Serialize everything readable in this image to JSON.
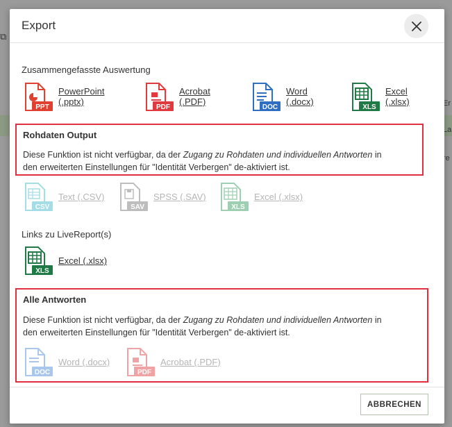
{
  "backdrop": {
    "right_text_1": "Er",
    "right_text_2": "La",
    "right_text_3": "re"
  },
  "dialog": {
    "title": "Export",
    "close_icon": "close-icon"
  },
  "sections": {
    "summary": {
      "title": "Zusammengefasste Auswertung",
      "items": [
        {
          "label_1": "PowerPoint",
          "label_2": "(.pptx)",
          "badge": "PPT",
          "color": "#e0402f"
        },
        {
          "label_1": "Acrobat",
          "label_2": "(.PDF)",
          "badge": "PDF",
          "color": "#e03a3e"
        },
        {
          "label_1": "Word",
          "label_2": "(.docx)",
          "badge": "DOC",
          "color": "#2f6fc2"
        },
        {
          "label_1": "Excel",
          "label_2": "(.xlsx)",
          "badge": "XLS",
          "color": "#1f7a45"
        }
      ]
    },
    "raw": {
      "title": "Rohdaten Output",
      "notice_pre": "Diese Funktion ist nicht verfügbar, da der ",
      "notice_em": "Zugang zu Rohdaten und individuellen Antworten",
      "notice_mid": " in",
      "notice_line2": "den erweiterten Einstellungen für \"Identität Verbergen\" de-aktiviert ist.",
      "items": [
        {
          "label": "Text (.CSV)",
          "badge": "CSV",
          "color": "#a5dde6"
        },
        {
          "label": "SPSS (.SAV)",
          "badge": "SAV",
          "color": "#bdbdbd"
        },
        {
          "label": "Excel (.xlsx)",
          "badge": "XLS",
          "color": "#9fcfb2"
        }
      ]
    },
    "livereport": {
      "title": "Links zu LiveReport(s)",
      "items": [
        {
          "label": "Excel (.xlsx)",
          "badge": "XLS",
          "color": "#1f7a45"
        }
      ]
    },
    "all_answers": {
      "title": "Alle Antworten",
      "notice_pre": "Diese Funktion ist nicht verfügbar, da der ",
      "notice_em": "Zugang zu Rohdaten und individuellen Antworten",
      "notice_mid": " in",
      "notice_line2": "den erweiterten Einstellungen für \"Identität Verbergen\" de-aktiviert ist.",
      "items": [
        {
          "label": "Word (.docx)",
          "badge": "DOC",
          "color": "#a9c7ec"
        },
        {
          "label": "Acrobat (.PDF)",
          "badge": "PDF",
          "color": "#f0a3a5"
        }
      ]
    }
  },
  "footer": {
    "cancel_label": "ABBRECHEN"
  }
}
